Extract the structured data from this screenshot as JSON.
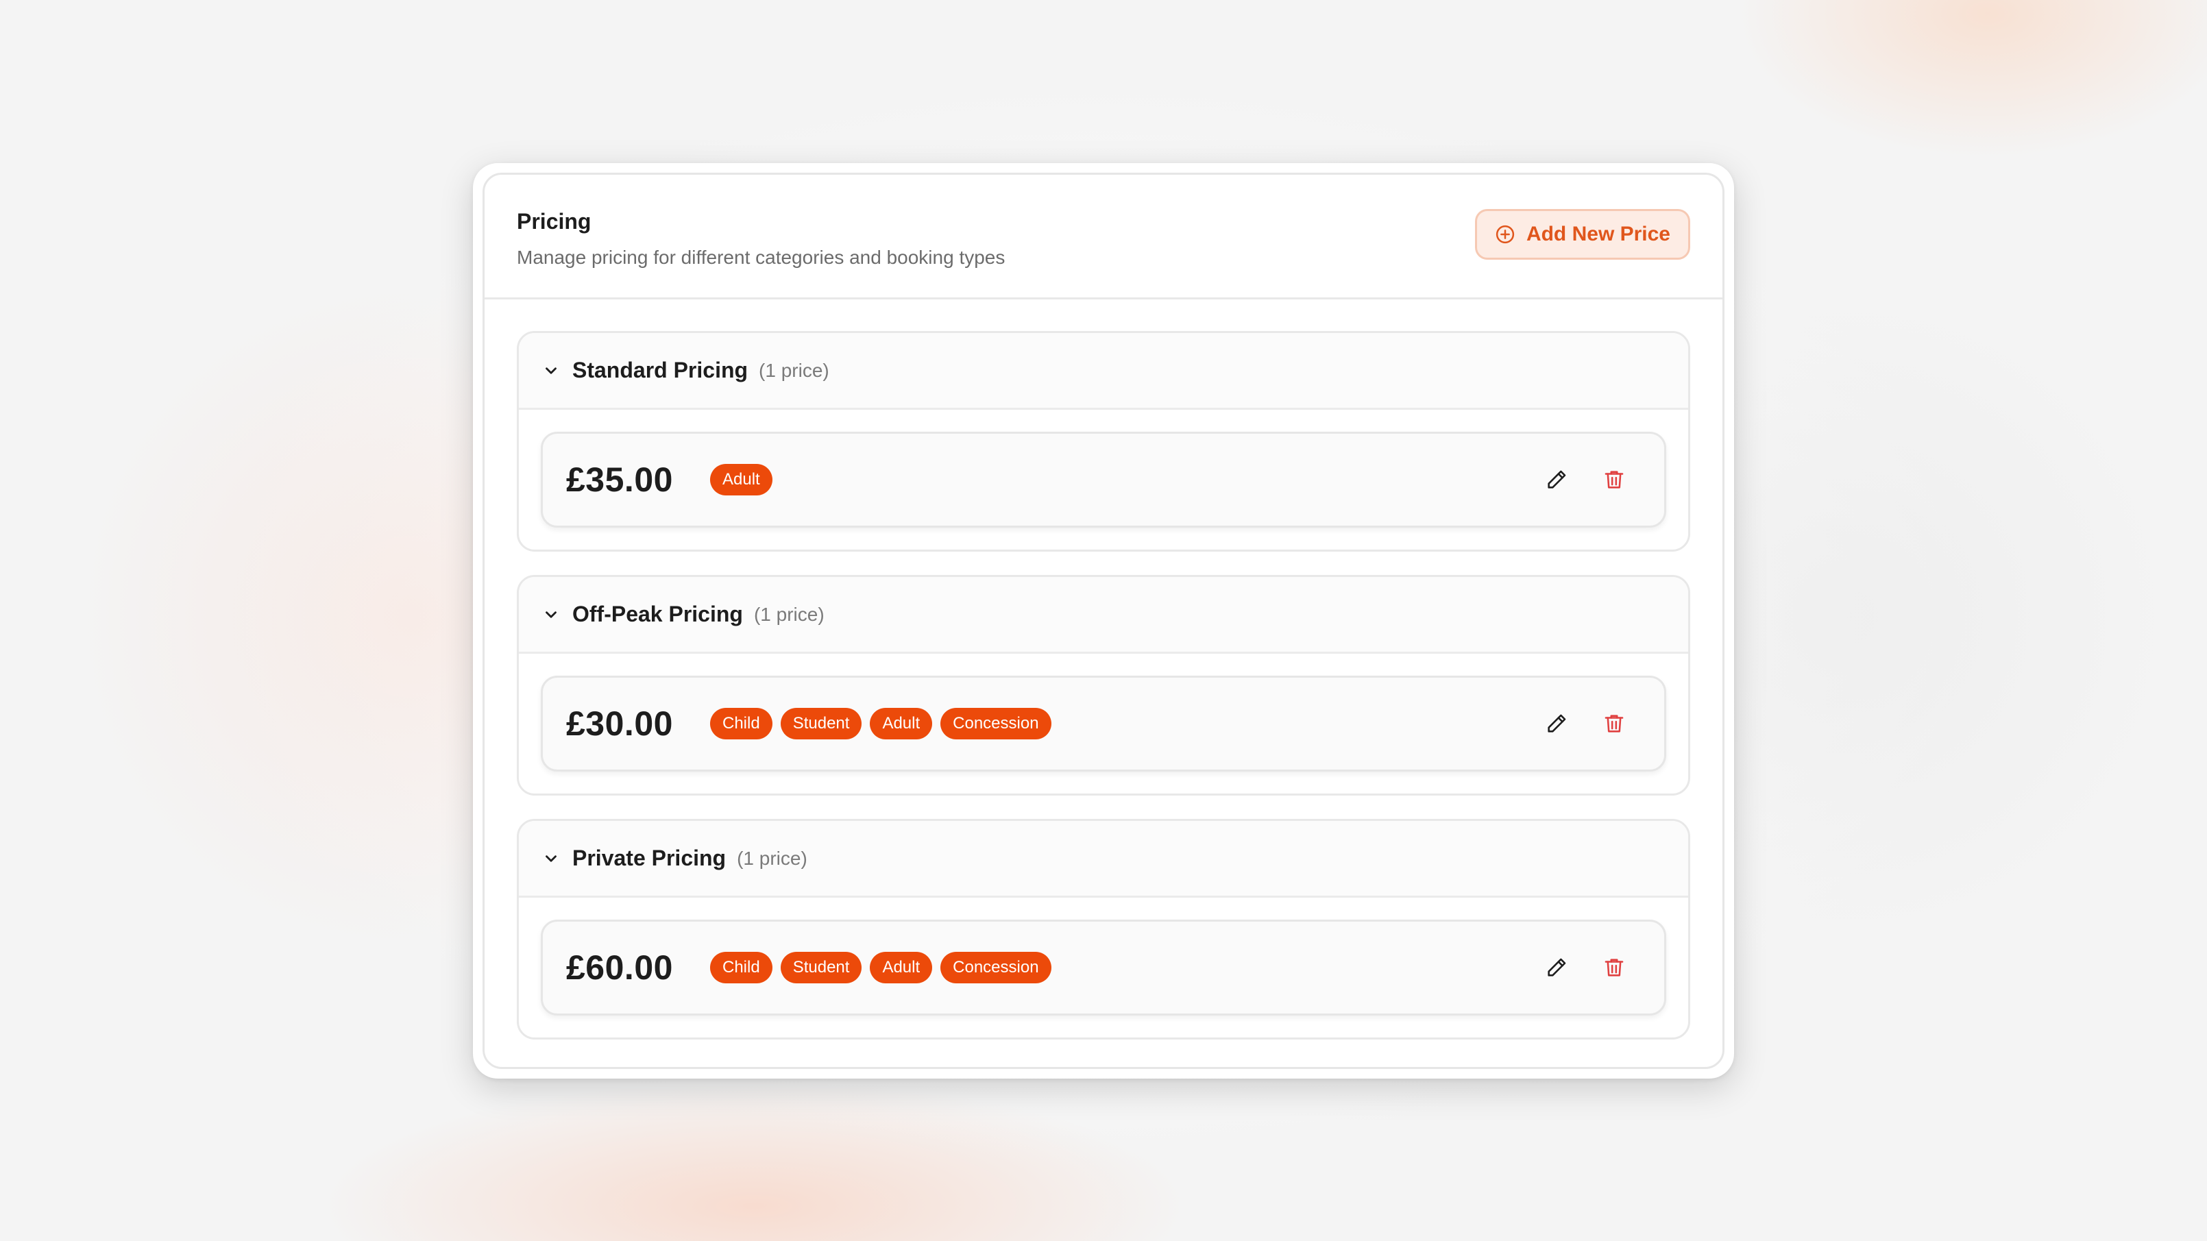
{
  "header": {
    "title": "Pricing",
    "subtitle": "Manage pricing for different categories and booking types",
    "add_button_label": "Add New Price"
  },
  "icons": {
    "add": "plus-circle-icon",
    "expand": "chevron-down-icon",
    "edit": "pencil-icon",
    "delete": "trash-icon"
  },
  "colors": {
    "accent": "#ec4a0a",
    "accent_text": "#e0561c",
    "accent_soft": "#fdece4",
    "delete": "#e04040"
  },
  "groups": [
    {
      "name": "Standard Pricing",
      "count": "(1 price)",
      "prices": [
        {
          "amount": "£35.00",
          "tags": [
            "Adult"
          ]
        }
      ]
    },
    {
      "name": "Off-Peak Pricing",
      "count": "(1 price)",
      "prices": [
        {
          "amount": "£30.00",
          "tags": [
            "Child",
            "Student",
            "Adult",
            "Concession"
          ]
        }
      ]
    },
    {
      "name": "Private Pricing",
      "count": "(1 price)",
      "prices": [
        {
          "amount": "£60.00",
          "tags": [
            "Child",
            "Student",
            "Adult",
            "Concession"
          ]
        }
      ]
    }
  ]
}
